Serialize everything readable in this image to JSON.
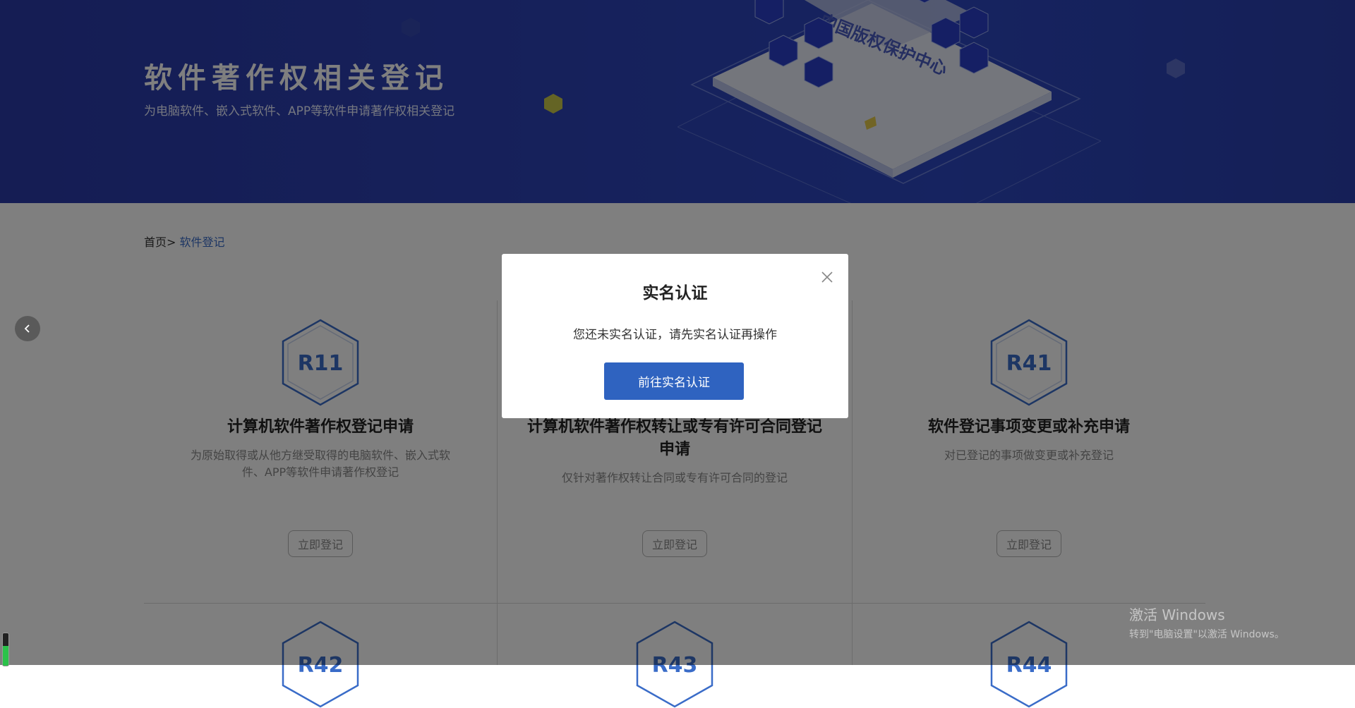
{
  "banner": {
    "title": "软件著作权相关登记",
    "subtitle": "为电脑软件、嵌入式软件、APP等软件申请著作权相关登记",
    "illustration_text": "中国版权保护中心"
  },
  "breadcrumb": {
    "home": "首页>",
    "current": "软件登记"
  },
  "cards": [
    {
      "code": "R11",
      "title": "计算机软件著作权登记申请",
      "desc": "为原始取得或从他方继受取得的电脑软件、嵌入式软件、APP等软件申请著作权登记",
      "button": "立即登记"
    },
    {
      "code": "",
      "title": "计算机软件著作权转让或专有许可合同登记申请",
      "desc": "仅针对著作权转让合同或专有许可合同的登记",
      "button": "立即登记"
    },
    {
      "code": "R41",
      "title": "软件登记事项变更或补充申请",
      "desc": "对已登记的事项做变更或补充登记",
      "button": "立即登记"
    }
  ],
  "next_row_codes": [
    "R42",
    "R43",
    "R44"
  ],
  "modal": {
    "title": "实名认证",
    "message": "您还未实名认证，请先实名认证再操作",
    "button": "前往实名认证"
  },
  "watermark": {
    "line1": "激活 Windows",
    "line2": "转到\"电脑设置\"以激活 Windows。"
  },
  "colors": {
    "banner": "#2d43b8",
    "accent": "#2f63c0",
    "hex_stroke": "#3a6cc8"
  }
}
